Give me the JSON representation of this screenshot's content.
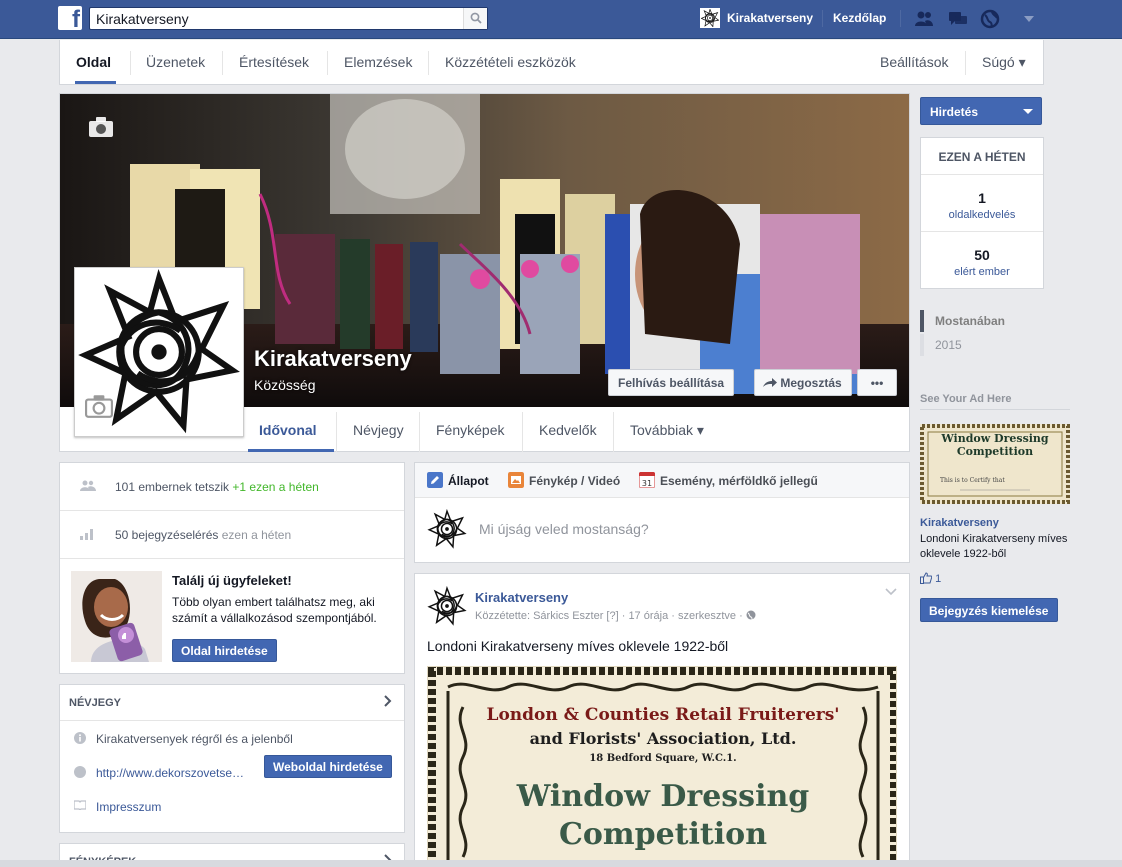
{
  "topbar": {
    "search_value": "Kirakatverseny",
    "profile_name": "Kirakatverseny",
    "home_label": "Kezdőlap",
    "icons": [
      "friend-requests-icon",
      "messages-icon",
      "notifications-globe-icon",
      "settings-caret-icon"
    ]
  },
  "admin_nav": {
    "tabs": [
      "Oldal",
      "Üzenetek",
      "Értesítések",
      "Elemzések",
      "Közzétételi eszközök"
    ],
    "settings": "Beállítások",
    "help": "Súgó ▾"
  },
  "page": {
    "name": "Kirakatverseny",
    "category": "Közösség",
    "cta_button": "Felhívás beállítása",
    "share_button": "Megosztás",
    "more_button": "•••",
    "tabs": [
      "Idővonal",
      "Névjegy",
      "Fényképek",
      "Kedvelők",
      "Továbbiak ▾"
    ]
  },
  "left": {
    "likes_text": "101 embernek tetszik",
    "likes_week": "+1 ezen a héten",
    "posts_text": "50 bejegyzéselérés",
    "posts_week": "ezen a héten",
    "promo_title": "Találj új ügyfeleket!",
    "promo_text": "Több olyan embert találhatsz meg, aki számít a vállalkozásod szempontjából.",
    "promo_button": "Oldal hirdetése",
    "about_head": "NÉVJEGY",
    "about_desc": "Kirakatversenyek régről és a jelenből",
    "about_url": "http://www.dekorszovetse…",
    "website_button": "Weboldal hirdetése",
    "about_impressum": "Impresszum",
    "photos_head": "FÉNYKÉPEK"
  },
  "composer": {
    "tab_status": "Állapot",
    "tab_photo": "Fénykép / Videó",
    "tab_event": "Esemény, mérföldkő jellegű",
    "placeholder": "Mi újság veled mostanság?"
  },
  "post": {
    "author": "Kirakatverseny",
    "meta": "Közzétette: Sárkics Eszter [?] · 17 órája · szerkesztve · ",
    "text": "Londoni Kirakatverseny míves oklevele 1922-ből",
    "image_line1": "London & Counties Retail Fruiterers'",
    "image_line2": "and Florists' Association, Ltd.",
    "image_line3": "18 Bedford Square, W.C.1.",
    "image_line4": "Window Dressing",
    "image_line5": "Competition"
  },
  "right": {
    "advertise_button": "Hirdetés",
    "week_head": "EZEN A HÉTEN",
    "page_likes_num": "1",
    "page_likes_label": "oldalkedvelés",
    "reach_num": "50",
    "reach_label": "elért ember",
    "recent_label": "Mostanában",
    "recent_year": "2015",
    "see_ad": "See Your Ad Here",
    "ad_img_line1": "Window Dressing",
    "ad_img_line2": "Competition",
    "ad_title": "Kirakatverseny",
    "ad_text": "Londoni Kirakatverseny míves oklevele 1922-ből",
    "ad_likes": "1",
    "boost_button": "Bejegyzés kiemelése"
  },
  "colors": {
    "fb_blue": "#3b5998",
    "button_blue": "#4267b2",
    "background": "#e9eaed",
    "green": "#42b72a"
  }
}
